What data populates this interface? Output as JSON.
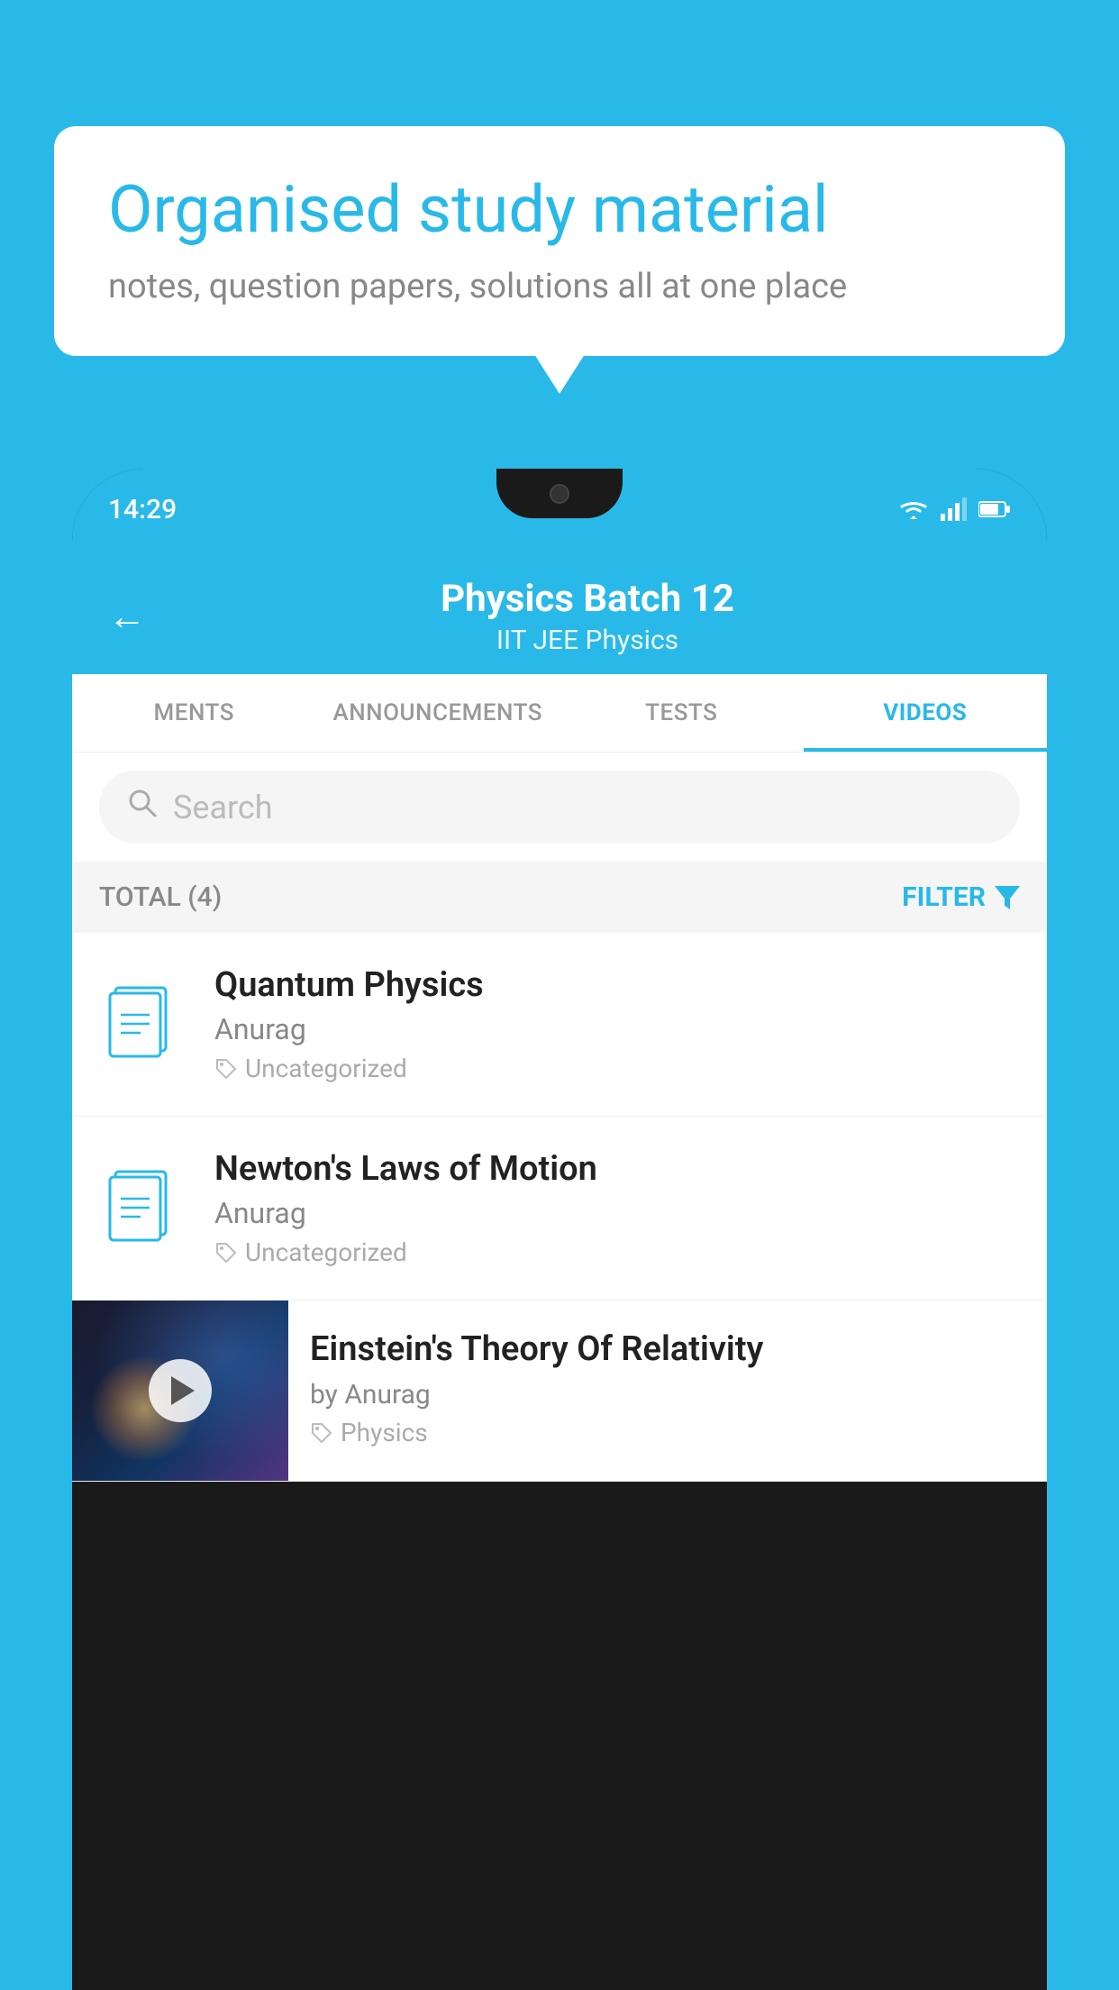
{
  "background_color": "#29B9E8",
  "speech_bubble": {
    "heading": "Organised study material",
    "subtext": "notes, question papers, solutions all at one place"
  },
  "phone": {
    "status_bar": {
      "time": "14:29"
    },
    "app_header": {
      "title": "Physics Batch 12",
      "subtitle": "IIT JEE   Physics",
      "back_label": "←"
    },
    "tabs": [
      {
        "label": "MENTS",
        "active": false
      },
      {
        "label": "ANNOUNCEMENTS",
        "active": false
      },
      {
        "label": "TESTS",
        "active": false
      },
      {
        "label": "VIDEOS",
        "active": true
      }
    ],
    "search": {
      "placeholder": "Search"
    },
    "filter_bar": {
      "total_label": "TOTAL (4)",
      "filter_label": "FILTER"
    },
    "videos": [
      {
        "id": "quantum",
        "title": "Quantum Physics",
        "author": "Anurag",
        "tag": "Uncategorized",
        "has_thumbnail": false
      },
      {
        "id": "newton",
        "title": "Newton's Laws of Motion",
        "author": "Anurag",
        "tag": "Uncategorized",
        "has_thumbnail": false
      },
      {
        "id": "einstein",
        "title": "Einstein's Theory Of Relativity",
        "author": "by Anurag",
        "tag": "Physics",
        "has_thumbnail": true
      }
    ]
  }
}
